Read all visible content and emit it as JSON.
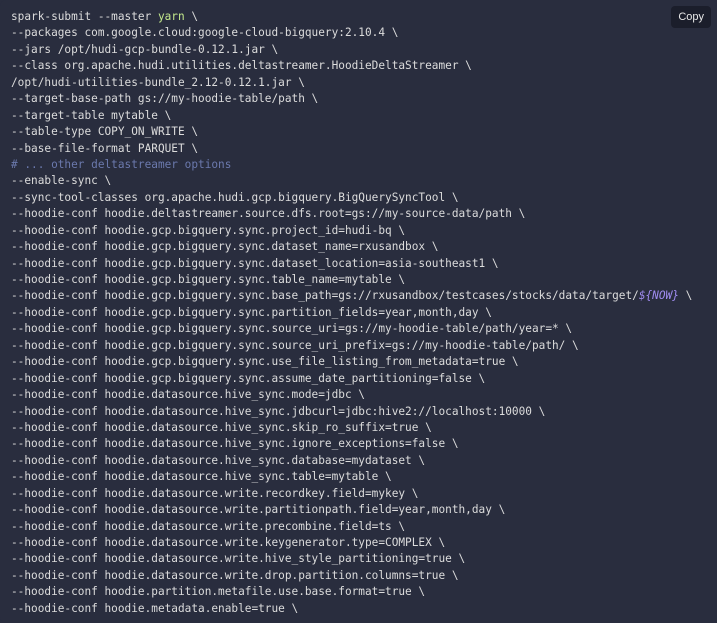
{
  "copy_button": {
    "label": "Copy"
  },
  "code": {
    "lines": [
      {
        "kind": "keyword",
        "pre": "spark-submit --master ",
        "token": "yarn",
        "post": " \\"
      },
      {
        "kind": "plain",
        "text": "--packages com.google.cloud:google-cloud-bigquery:2.10.4 \\"
      },
      {
        "kind": "plain",
        "text": "--jars /opt/hudi-gcp-bundle-0.12.1.jar \\"
      },
      {
        "kind": "plain",
        "text": "--class org.apache.hudi.utilities.deltastreamer.HoodieDeltaStreamer \\"
      },
      {
        "kind": "plain",
        "text": "/opt/hudi-utilities-bundle_2.12-0.12.1.jar \\"
      },
      {
        "kind": "plain",
        "text": "--target-base-path gs://my-hoodie-table/path \\"
      },
      {
        "kind": "plain",
        "text": "--target-table mytable \\"
      },
      {
        "kind": "plain",
        "text": "--table-type COPY_ON_WRITE \\"
      },
      {
        "kind": "plain",
        "text": "--base-file-format PARQUET \\"
      },
      {
        "kind": "comment",
        "text": "# ... other deltastreamer options"
      },
      {
        "kind": "plain",
        "text": "--enable-sync \\"
      },
      {
        "kind": "plain",
        "text": "--sync-tool-classes org.apache.hudi.gcp.bigquery.BigQuerySyncTool \\"
      },
      {
        "kind": "plain",
        "text": "--hoodie-conf hoodie.deltastreamer.source.dfs.root=gs://my-source-data/path \\"
      },
      {
        "kind": "plain",
        "text": "--hoodie-conf hoodie.gcp.bigquery.sync.project_id=hudi-bq \\"
      },
      {
        "kind": "plain",
        "text": "--hoodie-conf hoodie.gcp.bigquery.sync.dataset_name=rxusandbox \\"
      },
      {
        "kind": "plain",
        "text": "--hoodie-conf hoodie.gcp.bigquery.sync.dataset_location=asia-southeast1 \\"
      },
      {
        "kind": "plain",
        "text": "--hoodie-conf hoodie.gcp.bigquery.sync.table_name=mytable \\"
      },
      {
        "kind": "var",
        "pre": "--hoodie-conf hoodie.gcp.bigquery.sync.base_path=gs://rxusandbox/testcases/stocks/data/target/",
        "token": "${NOW}",
        "post": " \\"
      },
      {
        "kind": "plain",
        "text": "--hoodie-conf hoodie.gcp.bigquery.sync.partition_fields=year,month,day \\"
      },
      {
        "kind": "plain",
        "text": "--hoodie-conf hoodie.gcp.bigquery.sync.source_uri=gs://my-hoodie-table/path/year=* \\"
      },
      {
        "kind": "plain",
        "text": "--hoodie-conf hoodie.gcp.bigquery.sync.source_uri_prefix=gs://my-hoodie-table/path/ \\"
      },
      {
        "kind": "plain",
        "text": "--hoodie-conf hoodie.gcp.bigquery.sync.use_file_listing_from_metadata=true \\"
      },
      {
        "kind": "plain",
        "text": "--hoodie-conf hoodie.gcp.bigquery.sync.assume_date_partitioning=false \\"
      },
      {
        "kind": "plain",
        "text": "--hoodie-conf hoodie.datasource.hive_sync.mode=jdbc \\"
      },
      {
        "kind": "plain",
        "text": "--hoodie-conf hoodie.datasource.hive_sync.jdbcurl=jdbc:hive2://localhost:10000 \\"
      },
      {
        "kind": "plain",
        "text": "--hoodie-conf hoodie.datasource.hive_sync.skip_ro_suffix=true \\"
      },
      {
        "kind": "plain",
        "text": "--hoodie-conf hoodie.datasource.hive_sync.ignore_exceptions=false \\"
      },
      {
        "kind": "plain",
        "text": "--hoodie-conf hoodie.datasource.hive_sync.database=mydataset \\"
      },
      {
        "kind": "plain",
        "text": "--hoodie-conf hoodie.datasource.hive_sync.table=mytable \\"
      },
      {
        "kind": "plain",
        "text": "--hoodie-conf hoodie.datasource.write.recordkey.field=mykey \\"
      },
      {
        "kind": "plain",
        "text": "--hoodie-conf hoodie.datasource.write.partitionpath.field=year,month,day \\"
      },
      {
        "kind": "plain",
        "text": "--hoodie-conf hoodie.datasource.write.precombine.field=ts \\"
      },
      {
        "kind": "plain",
        "text": "--hoodie-conf hoodie.datasource.write.keygenerator.type=COMPLEX \\"
      },
      {
        "kind": "plain",
        "text": "--hoodie-conf hoodie.datasource.write.hive_style_partitioning=true \\"
      },
      {
        "kind": "plain",
        "text": "--hoodie-conf hoodie.datasource.write.drop.partition.columns=true \\"
      },
      {
        "kind": "plain",
        "text": "--hoodie-conf hoodie.partition.metafile.use.base.format=true \\"
      },
      {
        "kind": "plain",
        "text": "--hoodie-conf hoodie.metadata.enable=true \\"
      }
    ]
  }
}
